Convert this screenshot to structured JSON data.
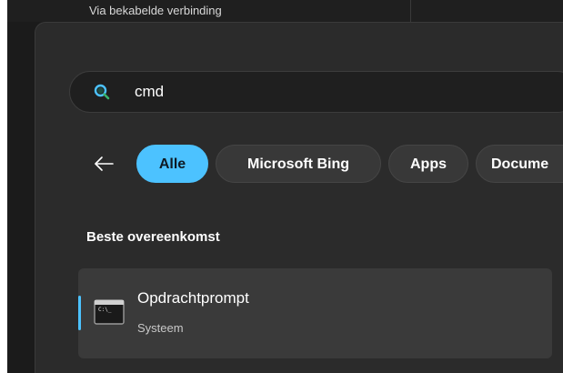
{
  "background_window": {
    "status_text": "Via bekabelde verbinding"
  },
  "search": {
    "query": "cmd",
    "icon": "search-icon"
  },
  "filters": {
    "back_icon": "arrow-left-icon",
    "chips": [
      {
        "label": "Alle",
        "active": true
      },
      {
        "label": "Microsoft Bing",
        "active": false
      },
      {
        "label": "Apps",
        "active": false
      },
      {
        "label": "Docume",
        "active": false
      }
    ]
  },
  "results": {
    "section_heading": "Beste overeenkomst",
    "best_match": {
      "title": "Opdrachtprompt",
      "subtitle": "Systeem",
      "icon": "command-prompt-icon"
    }
  },
  "colors": {
    "accent": "#4cc2ff",
    "panel_bg": "#2b2b2b",
    "result_bg": "#3a3a3a",
    "chip_bg": "#383838"
  }
}
